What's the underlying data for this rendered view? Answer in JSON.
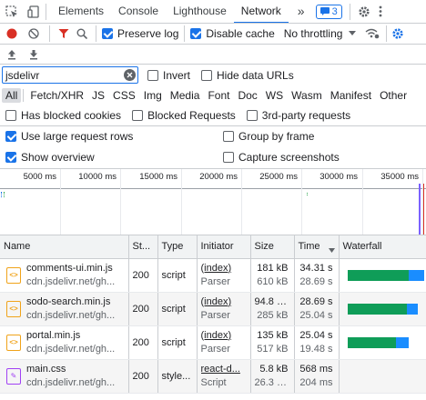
{
  "tabs": [
    "Elements",
    "Console",
    "Lighthouse",
    "Network"
  ],
  "active_tab": "Network",
  "more_tabs": "»",
  "badge_count": "3",
  "toolbar": {
    "preserve_log": "Preserve log",
    "disable_cache": "Disable cache",
    "throttling": "No throttling"
  },
  "filter": {
    "value": "jsdelivr",
    "invert": "Invert",
    "hide_data_urls": "Hide data URLs"
  },
  "types": [
    "All",
    "Fetch/XHR",
    "JS",
    "CSS",
    "Img",
    "Media",
    "Font",
    "Doc",
    "WS",
    "Wasm",
    "Manifest",
    "Other"
  ],
  "options": {
    "has_blocked_cookies": "Has blocked cookies",
    "blocked_requests": "Blocked Requests",
    "third_party": "3rd-party requests",
    "large_rows": "Use large request rows",
    "group_by_frame": "Group by frame",
    "show_overview": "Show overview",
    "capture_screenshots": "Capture screenshots"
  },
  "overview_ticks": [
    "5000 ms",
    "10000 ms",
    "15000 ms",
    "20000 ms",
    "25000 ms",
    "30000 ms",
    "35000 ms"
  ],
  "columns": {
    "name": "Name",
    "status": "St...",
    "type": "Type",
    "initiator": "Initiator",
    "size": "Size",
    "time": "Time",
    "waterfall": "Waterfall"
  },
  "rows": [
    {
      "name": "comments-ui.min.js",
      "domain": "cdn.jsdelivr.net/gh...",
      "status": "200",
      "type": "script",
      "initiator": "(index)",
      "initiator2": "Parser",
      "size": "181 kB",
      "size2": "610 kB",
      "time": "34.31 s",
      "time2": "28.69 s",
      "kind": "js",
      "wf_start": 0.04,
      "wf_wait": 0.8,
      "wf_end": 1.0
    },
    {
      "name": "sodo-search.min.js",
      "domain": "cdn.jsdelivr.net/gh...",
      "status": "200",
      "type": "script",
      "initiator": "(index)",
      "initiator2": "Parser",
      "size": "94.8 kB",
      "size2": "285 kB",
      "time": "28.69 s",
      "time2": "25.04 s",
      "kind": "js",
      "wf_start": 0.04,
      "wf_wait": 0.78,
      "wf_end": 0.92
    },
    {
      "name": "portal.min.js",
      "domain": "cdn.jsdelivr.net/gh...",
      "status": "200",
      "type": "script",
      "initiator": "(index)",
      "initiator2": "Parser",
      "size": "135 kB",
      "size2": "517 kB",
      "time": "25.04 s",
      "time2": "19.48 s",
      "kind": "js",
      "wf_start": 0.04,
      "wf_wait": 0.64,
      "wf_end": 0.8
    },
    {
      "name": "main.css",
      "domain": "cdn.jsdelivr.net/gh...",
      "status": "200",
      "type": "style...",
      "initiator": "react-d...",
      "initiator2": "Script",
      "size": "5.8 kB",
      "size2": "26.3 kB",
      "time": "568 ms",
      "time2": "204 ms",
      "kind": "css"
    }
  ]
}
